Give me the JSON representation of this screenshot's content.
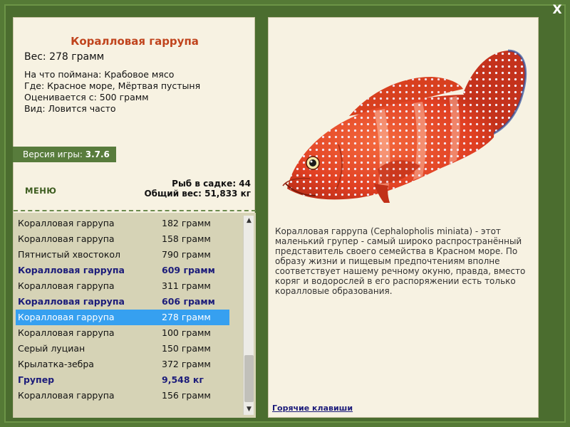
{
  "close_label": "X",
  "fish": {
    "title": "Коралловая гаррупа",
    "weight_line": "Вес: 278 грамм",
    "caught_on": "На что поймана: Крабовое мясо",
    "location": "Где: Красное море, Мёртвая пустыня",
    "valued_from": "Оценивается с: 500 грамм",
    "frequency": "Вид: Ловится часто"
  },
  "version": {
    "label": "Версия игры:",
    "value": "3.7.6"
  },
  "menu_label": "МЕНЮ",
  "stats": {
    "fish_count": "Рыб в садке: 44",
    "total_weight": "Общий вес: 51,833 кг"
  },
  "catch_list": [
    {
      "name": "Коралловая гаррупа",
      "weight": "182 грамм",
      "style": "normal"
    },
    {
      "name": "Коралловая гаррупа",
      "weight": "158 грамм",
      "style": "normal"
    },
    {
      "name": "Пятнистый хвостокол",
      "weight": "790 грамм",
      "style": "normal"
    },
    {
      "name": "Коралловая гаррупа",
      "weight": "609 грамм",
      "style": "bold"
    },
    {
      "name": "Коралловая гаррупа",
      "weight": "311 грамм",
      "style": "normal"
    },
    {
      "name": "Коралловая гаррупа",
      "weight": "606 грамм",
      "style": "bold"
    },
    {
      "name": "Коралловая гаррупа",
      "weight": "278 грамм",
      "style": "selected"
    },
    {
      "name": "Коралловая гаррупа",
      "weight": "100 грамм",
      "style": "normal"
    },
    {
      "name": "Серый луциан",
      "weight": "150 грамм",
      "style": "normal"
    },
    {
      "name": "Крылатка-зебра",
      "weight": "372 грамм",
      "style": "normal"
    },
    {
      "name": "Групер",
      "weight": "9,548 кг",
      "style": "bold"
    },
    {
      "name": "Коралловая гаррупа",
      "weight": "156 грамм",
      "style": "normal"
    }
  ],
  "description": "Коралловая гаррупа (Cephalopholis miniata) - этот маленький групер - самый широко распространённый представитель своего семейства в Красном море. По образу жизни и пищевым предпочтениям вполне соответствует нашему речному окуню, правда, вместо коряг и водорослей в его распоряжении есть только коралловые образования.",
  "hotkeys_label": "Горячие клавиши",
  "colors": {
    "frame_green": "#557a36",
    "panel_cream": "#f7f2e2",
    "title_orange": "#c0441d",
    "list_bg": "#d6d3b6",
    "selected_blue": "#36a0f0",
    "bold_navy": "#1c1c7a"
  },
  "icons": {
    "close": "close-icon",
    "scroll_up": "chevron-up-icon",
    "scroll_down": "chevron-down-icon"
  }
}
